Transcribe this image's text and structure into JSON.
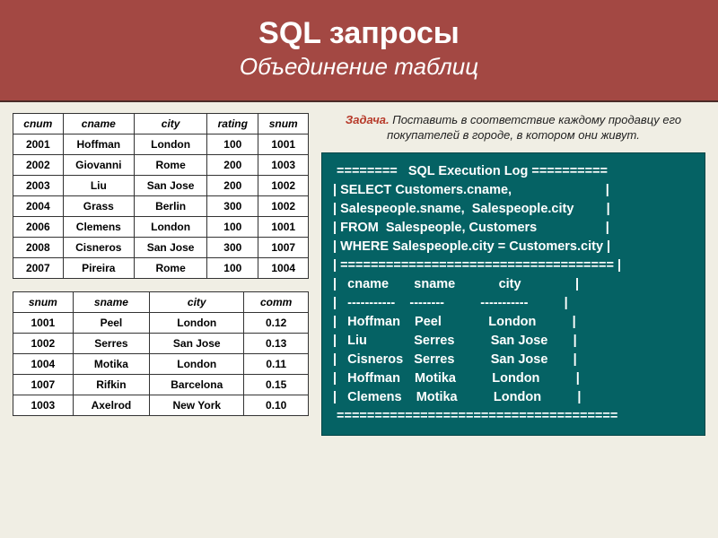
{
  "header": {
    "title": "SQL запросы",
    "subtitle": "Объединение таблиц"
  },
  "task": {
    "label": "Задача.",
    "text": "Поставить в соответствие каждому продавцу его покупателей в городе, в котором они живут."
  },
  "customers": {
    "headers": [
      "cnum",
      "cname",
      "city",
      "rating",
      "snum"
    ],
    "rows": [
      [
        "2001",
        "Hoffman",
        "London",
        "100",
        "1001"
      ],
      [
        "2002",
        "Giovanni",
        "Rome",
        "200",
        "1003"
      ],
      [
        "2003",
        "Liu",
        "San Jose",
        "200",
        "1002"
      ],
      [
        "2004",
        "Grass",
        "Berlin",
        "300",
        "1002"
      ],
      [
        "2006",
        "Clemens",
        "London",
        "100",
        "1001"
      ],
      [
        "2008",
        "Cisneros",
        "San Jose",
        "300",
        "1007"
      ],
      [
        "2007",
        "Pireira",
        "Rome",
        "100",
        "1004"
      ]
    ]
  },
  "salespeople": {
    "headers": [
      "snum",
      "sname",
      "city",
      "comm"
    ],
    "rows": [
      [
        "1001",
        "Peel",
        "London",
        "0.12"
      ],
      [
        "1002",
        "Serres",
        "San Jose",
        "0.13"
      ],
      [
        "1004",
        "Motika",
        "London",
        "0.11"
      ],
      [
        "1007",
        "Rifkin",
        "Barcelona",
        "0.15"
      ],
      [
        "1003",
        "Axelrod",
        "New York",
        "0.10"
      ]
    ]
  },
  "sql": {
    "lines": [
      " ========   SQL Execution Log ==========",
      "| SELECT Customers.cname,                          |",
      "| Salespeople.sname,  Salespeople.city         |",
      "| FROM  Salespeople, Customers                   |",
      "| WHERE Salespeople.city = Customers.city |",
      "| ==================================== |",
      "|   cname       sname            city               |",
      "|   -----------    --------          -----------          |",
      "|   Hoffman    Peel             London          |",
      "|   Liu             Serres          San Jose       |",
      "|   Cisneros   Serres          San Jose       |",
      "|   Hoffman    Motika          London          |",
      "|   Clemens    Motika          London          |",
      " ====================================="
    ]
  }
}
